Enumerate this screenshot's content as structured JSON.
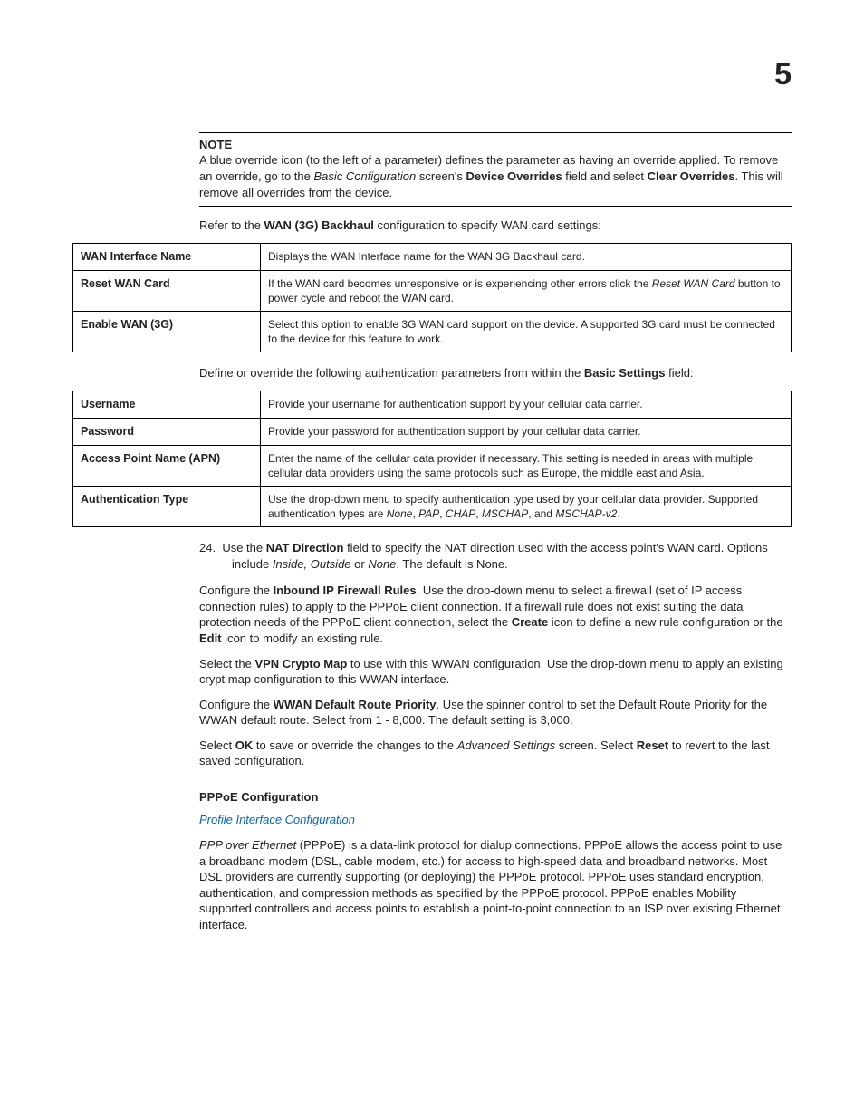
{
  "page_number": "5",
  "note": {
    "title": "NOTE",
    "body": {
      "p1a": "A blue override icon (to the left of a parameter) defines the parameter as having an override applied. To remove an override, go to the ",
      "p1b_i": "Basic Configuration",
      "p1c": " screen's ",
      "p1d_b": "Device Overrides",
      "p1e": " field and select ",
      "p1f_b": "Clear Overrides",
      "p1g": ". This will remove all overrides from the device."
    }
  },
  "intro1": {
    "a": "Refer to the ",
    "b_b": "WAN (3G) Backhaul",
    "c": " configuration to specify WAN card settings:"
  },
  "table1": [
    {
      "label": "WAN Interface Name",
      "desc": {
        "a": "Displays the WAN Interface name for the WAN 3G Backhaul card."
      }
    },
    {
      "label": "Reset WAN Card",
      "desc": {
        "a": "If the WAN card becomes unresponsive or is experiencing other errors click the ",
        "b_i": "Reset WAN Card",
        "c": " button to power cycle and reboot the WAN card."
      }
    },
    {
      "label": "Enable WAN (3G)",
      "desc": {
        "a": "Select this option to enable 3G WAN card support on the device. A supported 3G card must be connected to the device for this feature to work."
      }
    }
  ],
  "intro2": {
    "a": "Define or override the following authentication parameters from within the ",
    "b_b": "Basic Settings",
    "c": " field:"
  },
  "table2": [
    {
      "label": "Username",
      "desc": {
        "a": "Provide your username for authentication support by your cellular data carrier."
      }
    },
    {
      "label": "Password",
      "desc": {
        "a": "Provide your password for authentication support by your cellular data carrier."
      }
    },
    {
      "label": "Access Point Name (APN)",
      "desc": {
        "a": "Enter the name of the cellular data provider if necessary. This setting is needed in areas with multiple cellular data providers using the same protocols such as Europe, the middle east and Asia."
      }
    },
    {
      "label": "Authentication Type",
      "desc": {
        "a": "Use the drop-down menu to specify authentication type used by your cellular data provider. Supported authentication types are ",
        "b_i": "None",
        "c": ", ",
        "d_i": "PAP",
        "e": ", ",
        "f_i": "CHAP",
        "g": ", ",
        "h_i": "MSCHAP",
        "i": ", and ",
        "j_i": "MSCHAP-v2",
        "k": "."
      }
    }
  ],
  "step24": {
    "num": "24.",
    "a": "Use the ",
    "b_b": "NAT Direction",
    "c": " field to specify the NAT direction used with the access point's WAN card. Options include ",
    "d_i": "Inside, Outside",
    "e": " or ",
    "f_i": "None",
    "g": ". The default is None."
  },
  "para_fw": {
    "a": "Configure the ",
    "b_b": "Inbound IP Firewall Rules",
    "c": ". Use the drop-down menu to select a firewall (set of IP access connection rules) to apply to the PPPoE client connection. If a firewall rule does not exist suiting the data protection needs of the PPPoE client connection, select the ",
    "d_b": "Create",
    "e": " icon to define a new rule configuration or the ",
    "f_b": "Edit",
    "g": " icon to modify an existing rule."
  },
  "para_vpn": {
    "a": "Select the ",
    "b_b": "VPN Crypto Map",
    "c": " to use with this WWAN configuration. Use the drop-down menu to apply an existing crypt map configuration to this WWAN interface."
  },
  "para_route": {
    "a": "Configure the ",
    "b_b": "WWAN Default Route Priority",
    "c": ". Use the spinner control to set the Default Route Priority for the WWAN default route. Select from 1 - 8,000. The default setting is 3,000."
  },
  "para_okreset": {
    "a": "Select ",
    "b_b": "OK",
    "c": " to save or override the changes to the ",
    "d_i": "Advanced Settings",
    "e": " screen. Select ",
    "f_b": "Reset",
    "g": " to revert to the last saved configuration."
  },
  "pppoe": {
    "title": "PPPoE Configuration",
    "link": "Profile Interface Configuration",
    "body": {
      "a_i": "PPP over Ethernet",
      "b": " (PPPoE) is a data-link protocol for dialup connections. PPPoE allows the access point to use a broadband modem (DSL, cable modem, etc.) for access to high-speed data and broadband networks. Most DSL providers are currently supporting (or deploying) the PPPoE protocol. PPPoE uses standard encryption, authentication, and compression methods as specified by the PPPoE protocol. PPPoE enables Mobility supported controllers and access points to establish a point-to-point connection to an ISP over existing Ethernet interface."
    }
  }
}
